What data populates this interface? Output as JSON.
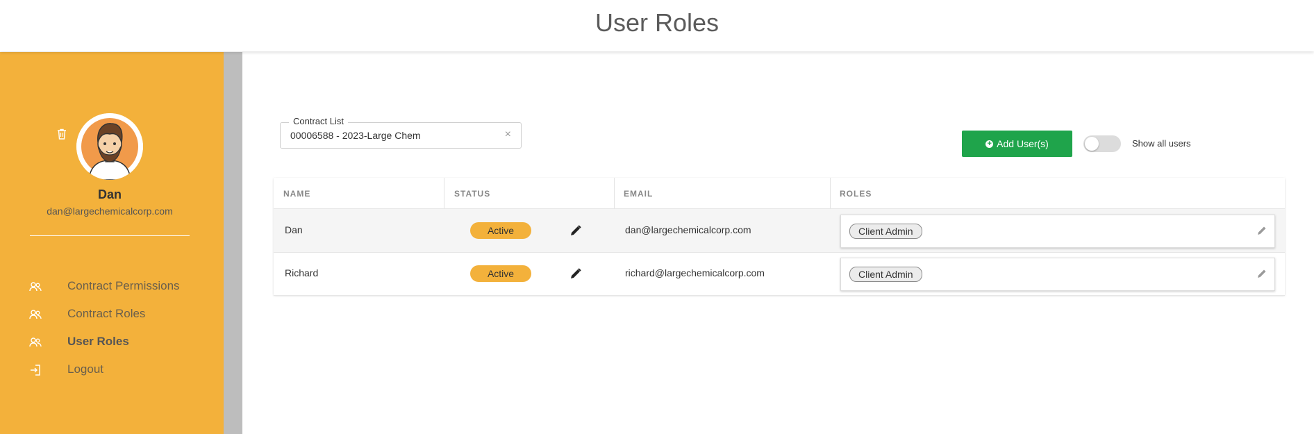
{
  "header": {
    "title": "User Roles"
  },
  "sidebar": {
    "user": {
      "name": "Dan",
      "email": "dan@largechemicalcorp.com",
      "avatar_icon": "avatar-icon"
    },
    "delete_icon": "trash-icon",
    "items": [
      {
        "label": "Contract Permissions",
        "icon": "users-icon",
        "active": false
      },
      {
        "label": "Contract Roles",
        "icon": "users-icon",
        "active": false
      },
      {
        "label": "User Roles",
        "icon": "users-icon",
        "active": true
      },
      {
        "label": "Logout",
        "icon": "logout-icon",
        "active": false
      }
    ]
  },
  "filters": {
    "contract_label": "Contract List",
    "contract_value": "00006588 - 2023-Large Chem",
    "clear_symbol": "×"
  },
  "actions": {
    "add_users_label": "Add User(s)",
    "show_all_label": "Show all users",
    "show_all_checked": false
  },
  "table": {
    "columns": [
      "NAME",
      "STATUS",
      "EMAIL",
      "ROLES"
    ],
    "rows": [
      {
        "name": "Dan",
        "status": "Active",
        "email": "dan@largechemicalcorp.com",
        "roles": [
          "Client Admin"
        ]
      },
      {
        "name": "Richard",
        "status": "Active",
        "email": "richard@largechemicalcorp.com",
        "roles": [
          "Client Admin"
        ]
      }
    ]
  },
  "colors": {
    "sidebar": "#f3b13b",
    "status_active": "#f3b13b",
    "add_button": "#1fa44b"
  }
}
